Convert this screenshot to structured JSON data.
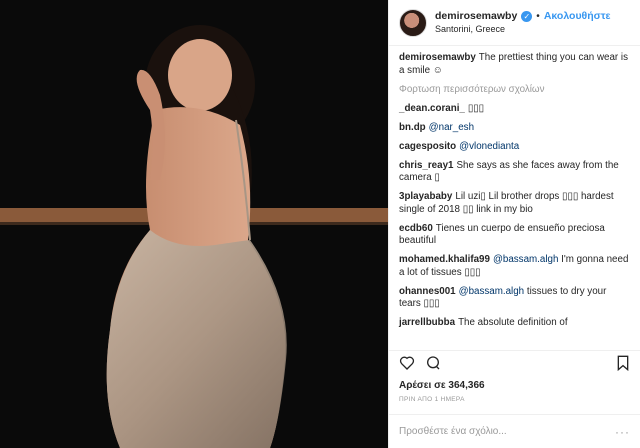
{
  "header": {
    "username": "demirosemawby",
    "separator": "•",
    "follow_label": "Ακολουθήστε",
    "location": "Santorini, Greece"
  },
  "caption": {
    "username": "demirosemawby",
    "text": "The prettiest thing you can wear is a smile ☺"
  },
  "load_more": "Φορτωση περισσότερων σχολίων",
  "comments": [
    {
      "username": "_dean.corani_",
      "text": "▯▯▯"
    },
    {
      "username": "bn.dp",
      "mention": "@nar_esh",
      "text": ""
    },
    {
      "username": "cagesposito",
      "mention": "@vlonedianta",
      "text": ""
    },
    {
      "username": "chris_reay1",
      "text": "She says as she faces away from the camera ▯"
    },
    {
      "username": "3playababy",
      "text": "Lil uzi▯ Lil brother drops ▯▯▯ hardest single of 2018 ▯▯ link in my bio"
    },
    {
      "username": "ecdb60",
      "text": "Tienes un cuerpo de ensueño preciosa beautiful"
    },
    {
      "username": "mohamed.khalifa99",
      "mention": "@bassam.algh",
      "text": "I'm gonna need a lot of tissues ▯▯▯"
    },
    {
      "username": "ohannes001",
      "mention": "@bassam.algh",
      "text": "tissues to dry your tears ▯▯▯"
    },
    {
      "username": "jarrellbubba",
      "text": "The absolute definition of"
    }
  ],
  "icons": [
    "heart-icon",
    "comment-icon",
    "bookmark-icon",
    "verified-icon",
    "more-options-icon"
  ],
  "likes": "Αρέσει σε 364,366",
  "time_ago": "ΠΡΙΝ ΑΠΟ 1 ΗΜΕΡΑ",
  "add_comment_placeholder": "Προσθέστε ένα σχόλιο...",
  "more_options": "···",
  "colors": {
    "accent": "#3897f0",
    "mention": "#003569",
    "muted": "#999999"
  }
}
